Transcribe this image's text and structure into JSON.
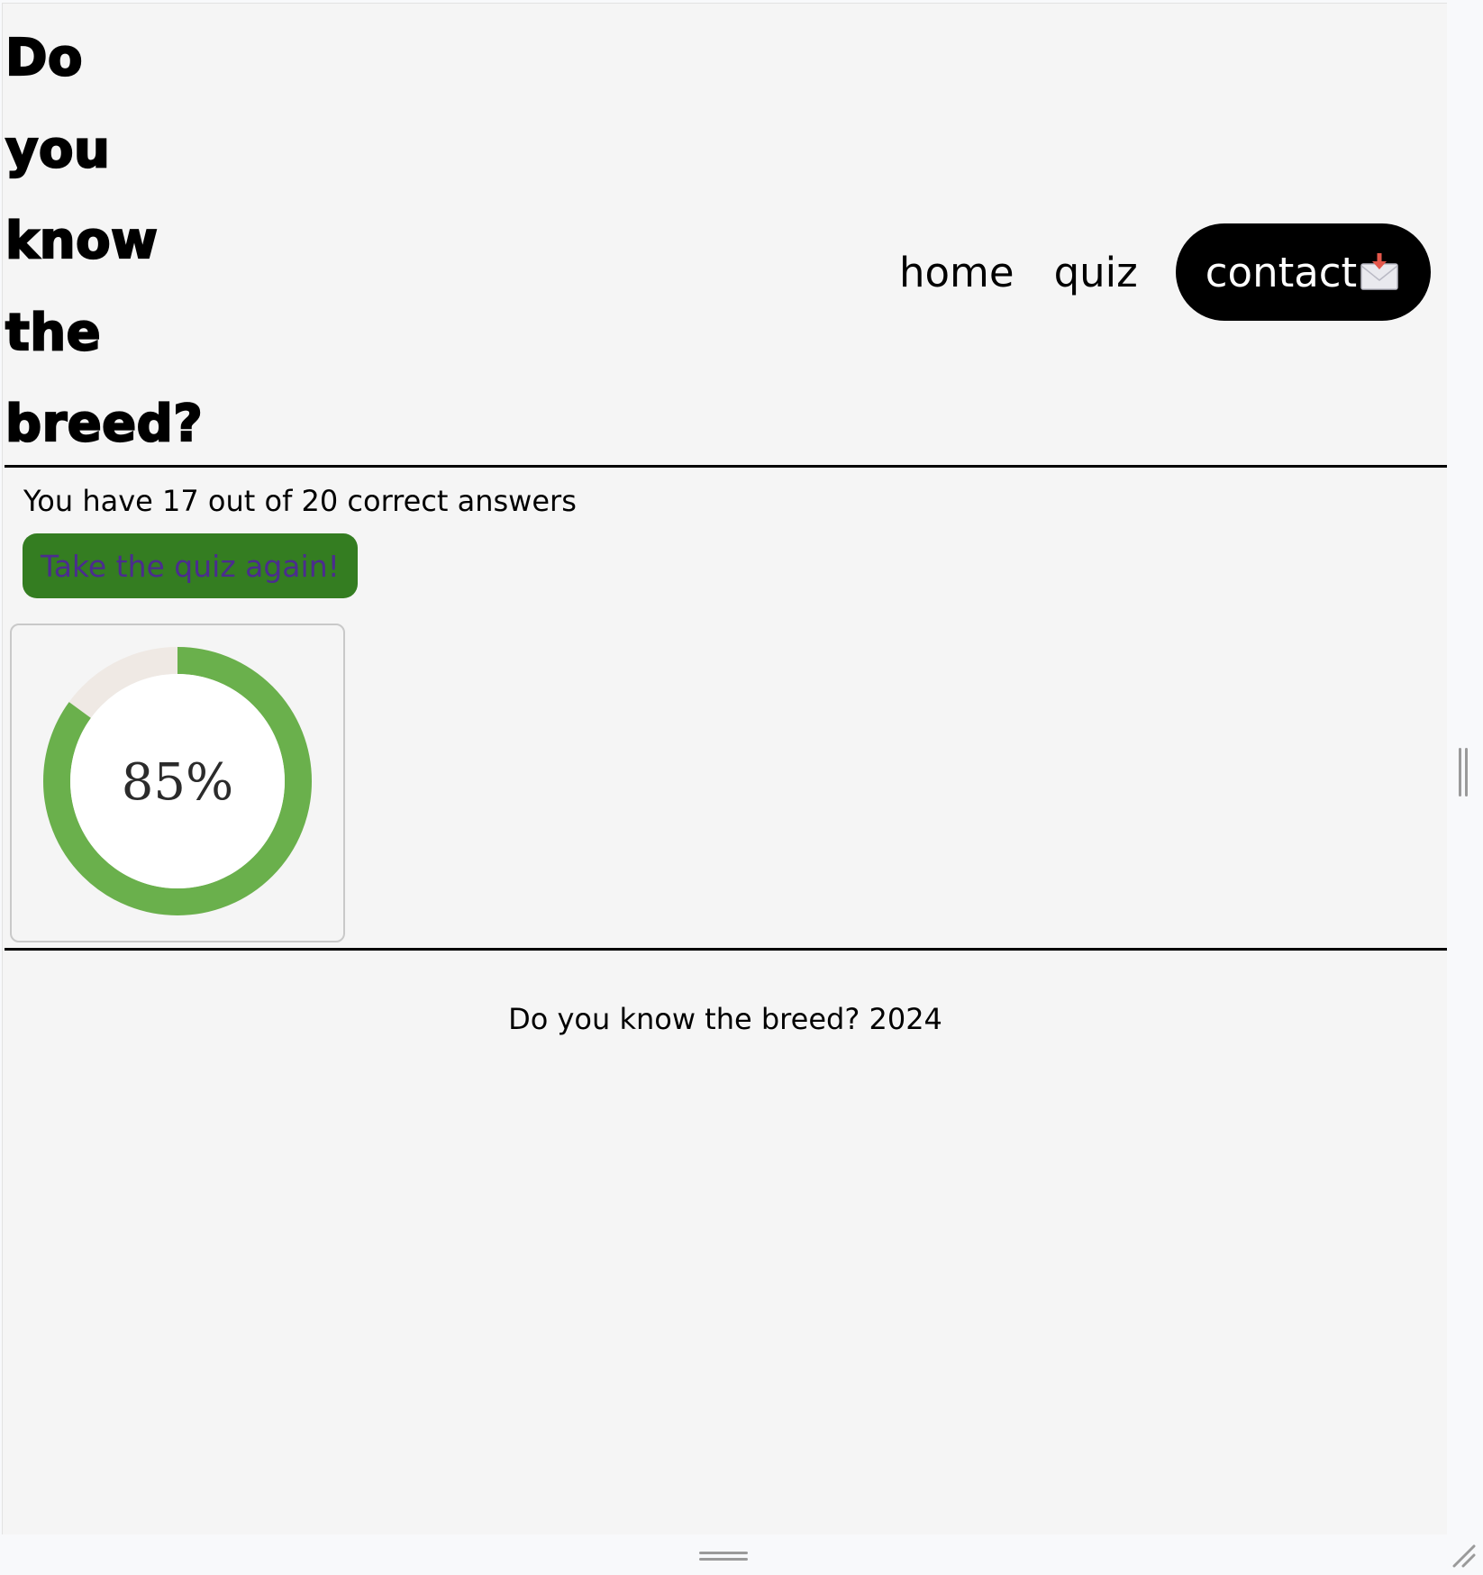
{
  "header": {
    "title_lines": [
      "Do",
      "you",
      "know",
      "the",
      "breed?"
    ]
  },
  "nav": {
    "home": "home",
    "quiz": "quiz",
    "contact": "contact"
  },
  "results": {
    "score_text": "You have 17 out of 20 correct answers",
    "retry_label": "Take the quiz again!"
  },
  "chart_data": {
    "type": "pie",
    "label": "85%",
    "values": [
      85,
      15
    ],
    "colors": [
      "#6ab04c",
      "#efe9e4"
    ]
  },
  "footer": {
    "text": "Do you know the breed? 2024"
  },
  "icons": {
    "contact_icon": "envelope-with-arrow-icon"
  }
}
